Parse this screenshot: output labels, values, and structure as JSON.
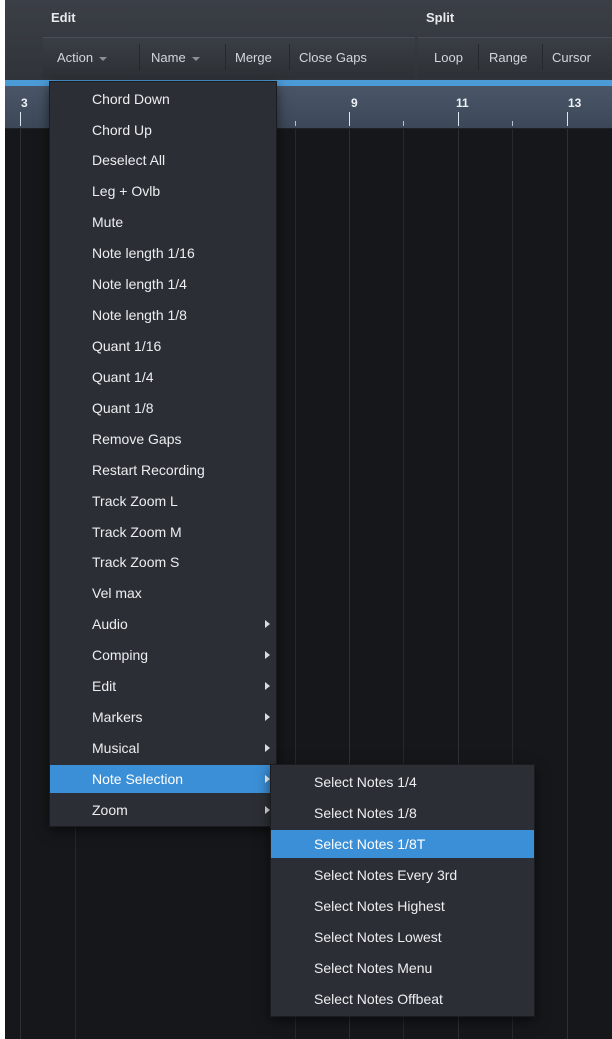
{
  "toolbar": {
    "edit_group": {
      "title": "Edit",
      "buttons": [
        {
          "label": "Action",
          "dropdown": true
        },
        {
          "label": "Name",
          "dropdown": true
        },
        {
          "label": "Merge",
          "dropdown": false
        },
        {
          "label": "Close Gaps",
          "dropdown": false
        }
      ]
    },
    "split_group": {
      "title": "Split",
      "buttons": [
        {
          "label": "Loop"
        },
        {
          "label": "Range"
        },
        {
          "label": "Cursor"
        }
      ]
    }
  },
  "ruler": {
    "bars": [
      "3",
      "9",
      "11",
      "13"
    ]
  },
  "action_menu": {
    "items": [
      {
        "label": "Chord Down",
        "submenu": false
      },
      {
        "label": "Chord Up",
        "submenu": false
      },
      {
        "label": "Deselect All",
        "submenu": false
      },
      {
        "label": "Leg + Ovlb",
        "submenu": false
      },
      {
        "label": "Mute",
        "submenu": false
      },
      {
        "label": "Note length 1/16",
        "submenu": false
      },
      {
        "label": "Note length 1/4",
        "submenu": false
      },
      {
        "label": "Note length 1/8",
        "submenu": false
      },
      {
        "label": "Quant 1/16",
        "submenu": false
      },
      {
        "label": "Quant 1/4",
        "submenu": false
      },
      {
        "label": "Quant 1/8",
        "submenu": false
      },
      {
        "label": "Remove Gaps",
        "submenu": false
      },
      {
        "label": "Restart Recording",
        "submenu": false
      },
      {
        "label": "Track Zoom L",
        "submenu": false
      },
      {
        "label": "Track Zoom M",
        "submenu": false
      },
      {
        "label": "Track Zoom S",
        "submenu": false
      },
      {
        "label": "Vel max",
        "submenu": false
      },
      {
        "label": "Audio",
        "submenu": true
      },
      {
        "label": "Comping",
        "submenu": true
      },
      {
        "label": "Edit",
        "submenu": true
      },
      {
        "label": "Markers",
        "submenu": true
      },
      {
        "label": "Musical",
        "submenu": true
      },
      {
        "label": "Note Selection",
        "submenu": true,
        "active": true
      },
      {
        "label": "Zoom",
        "submenu": true
      }
    ]
  },
  "note_selection_submenu": {
    "items": [
      {
        "label": "Select Notes 1/4"
      },
      {
        "label": "Select Notes 1/8"
      },
      {
        "label": "Select Notes 1/8T",
        "active": true
      },
      {
        "label": "Select Notes Every 3rd"
      },
      {
        "label": "Select Notes Highest"
      },
      {
        "label": "Select Notes Lowest"
      },
      {
        "label": "Select Notes Menu"
      },
      {
        "label": "Select Notes Offbeat"
      }
    ]
  },
  "colors": {
    "highlight": "#3b8fd6",
    "menu_bg": "#2b2f35",
    "ruler_accent": "#4b9bd6"
  }
}
